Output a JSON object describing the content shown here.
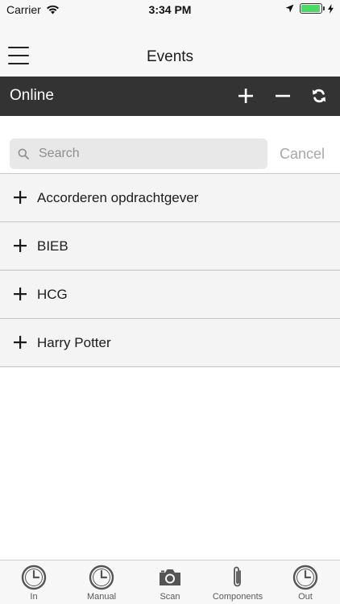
{
  "status_bar": {
    "carrier": "Carrier",
    "time": "3:34 PM",
    "battery_level": 0.95,
    "battery_color": "#4cd964"
  },
  "nav": {
    "title": "Events",
    "menu_icon": "hamburger-menu-icon"
  },
  "toolbar": {
    "title": "Online",
    "background": "#333333",
    "actions": [
      {
        "icon": "plus-icon"
      },
      {
        "icon": "minus-icon"
      },
      {
        "icon": "refresh-icon"
      }
    ]
  },
  "search": {
    "placeholder": "Search",
    "value": "",
    "cancel_label": "Cancel"
  },
  "events": [
    {
      "label": "Accorderen opdrachtgever",
      "icon": "plus-icon"
    },
    {
      "label": "BIEB",
      "icon": "plus-icon"
    },
    {
      "label": "HCG",
      "icon": "plus-icon"
    },
    {
      "label": "Harry Potter",
      "icon": "plus-icon"
    }
  ],
  "tabbar": {
    "tabs": [
      {
        "label": "In",
        "icon": "clock-icon"
      },
      {
        "label": "Manual",
        "icon": "clock-icon"
      },
      {
        "label": "Scan",
        "icon": "camera-icon"
      },
      {
        "label": "Components",
        "icon": "paperclip-icon"
      },
      {
        "label": "Out",
        "icon": "clock-icon"
      }
    ]
  }
}
